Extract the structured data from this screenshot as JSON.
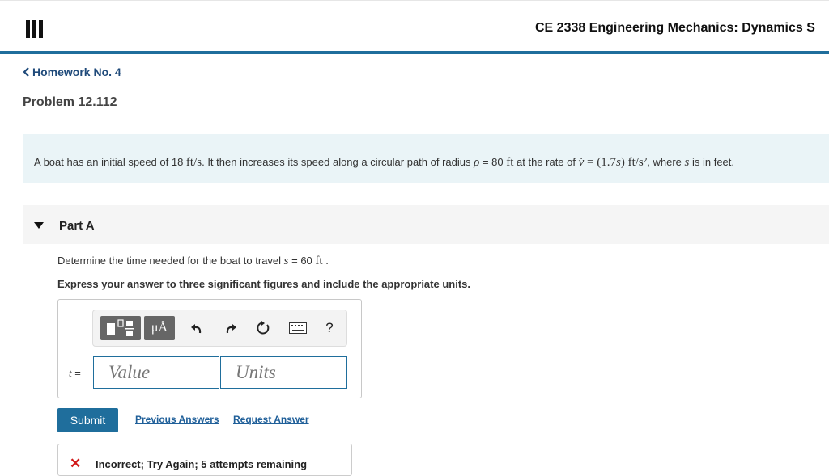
{
  "header": {
    "course_title": "CE 2338 Engineering Mechanics: Dynamics S",
    "accent_color": "#1f6e9c"
  },
  "nav": {
    "back_label": "Homework No. 4",
    "back_icon": "chevron-left-icon"
  },
  "problem": {
    "title": "Problem 12.112",
    "statement": {
      "p1": "A boat has an initial speed of 18 ",
      "unit1": "ft/s",
      "p2": ". It then increases its speed along a circular path of radius ",
      "rho": "ρ",
      "p3": " = 80 ",
      "unit2": "ft",
      "p4": " at the rate of ",
      "vdot": "v̇",
      "eq": " = (1.7",
      "s_var": "s",
      "eq2": ") ft/s²",
      "p5": ", where ",
      "s_var2": "s",
      "p6": " is in feet."
    }
  },
  "part": {
    "label": "Part A",
    "question": {
      "p1": "Determine the time needed for the boat to travel ",
      "s_var": "s",
      "p2": " = 60 ",
      "unit": "ft",
      "p3": " ."
    },
    "instruction": "Express your answer to three significant figures and include the appropriate units.",
    "toolbar": {
      "units_label": "μÅ",
      "help_label": "?"
    },
    "variable_label": "t",
    "variable_eq": " =",
    "value_placeholder": "Value",
    "units_placeholder": "Units",
    "submit_label": "Submit",
    "previous_answers_label": "Previous Answers",
    "request_answer_label": "Request Answer",
    "feedback": {
      "icon": "x-mark-icon",
      "text": "Incorrect; Try Again; 5 attempts remaining",
      "color": "#d21a1a"
    }
  }
}
